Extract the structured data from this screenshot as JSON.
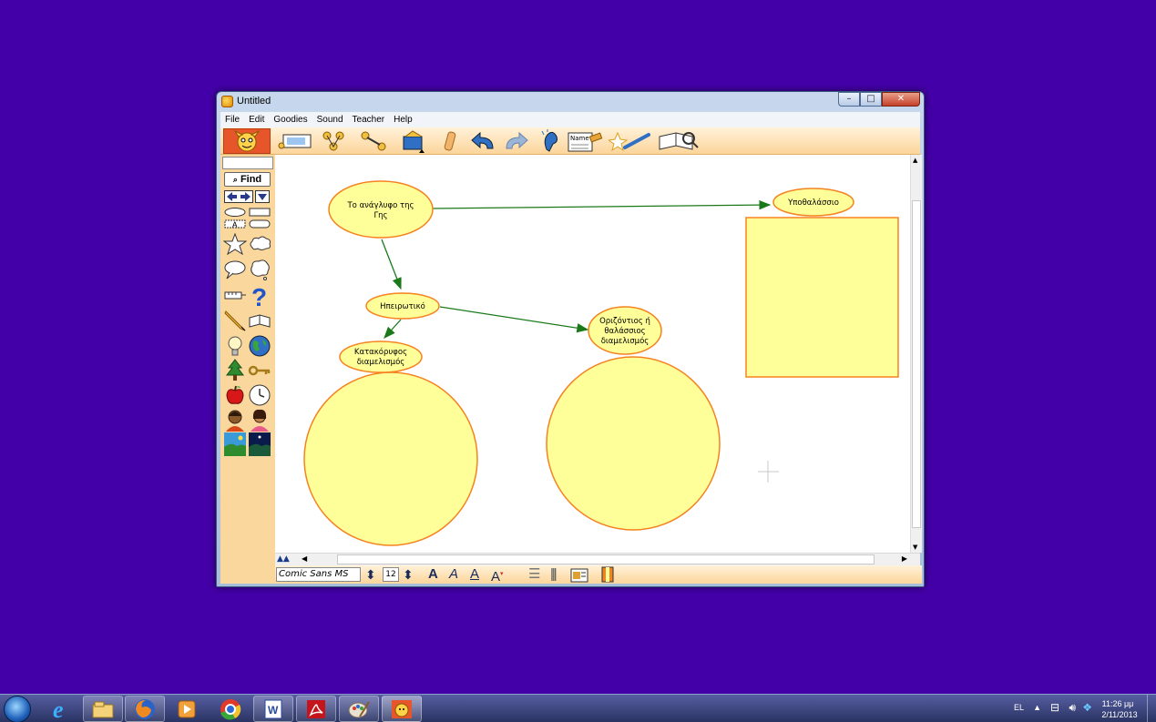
{
  "window": {
    "title": "Untitled",
    "controls": {
      "minimize": "–",
      "maximize": "□",
      "close": "✕"
    }
  },
  "menu": [
    "File",
    "Edit",
    "Goodies",
    "Sound",
    "Teacher",
    "Help"
  ],
  "toolbar": {
    "icons": [
      "picture-icon",
      "arrange-icon",
      "link-icon",
      "symbol-box-icon",
      "eraser-icon",
      "undo-icon",
      "redo-icon",
      "listen-icon",
      "name-tag-icon",
      "sparkle-icon",
      "notes-icon"
    ],
    "name_tag_text": "Name"
  },
  "palette": {
    "find_label": "Find",
    "text_box_label": "A"
  },
  "diagram": {
    "nodes": {
      "relief": {
        "text": [
          "Το ανάγλυφο της",
          "Γης"
        ]
      },
      "seabed": {
        "text": [
          "Υποθαλάσσιο"
        ]
      },
      "continental": {
        "text": [
          "Ηπειρωτικό"
        ]
      },
      "vertical": {
        "text": [
          "Κατακόρυφος",
          "διαμελισμός"
        ]
      },
      "horizontal": {
        "text": [
          "Οριζόντιος ή",
          "θαλάσσιος",
          "διαμελισμός"
        ]
      }
    },
    "fill_color": "#ffff99",
    "stroke_color": "#f58220",
    "link_color": "#1a7a1a"
  },
  "format": {
    "font_name": "Comic Sans MS",
    "font_size": "12"
  },
  "taskbar": {
    "apps": [
      "ie-icon",
      "explorer-icon",
      "firefox-icon",
      "media-player-icon",
      "chrome-icon",
      "word-icon",
      "acrobat-icon",
      "paint-icon",
      "kidspiration-icon"
    ],
    "lang": "EL",
    "time": "11:26 μμ",
    "date": "2/11/2013"
  }
}
